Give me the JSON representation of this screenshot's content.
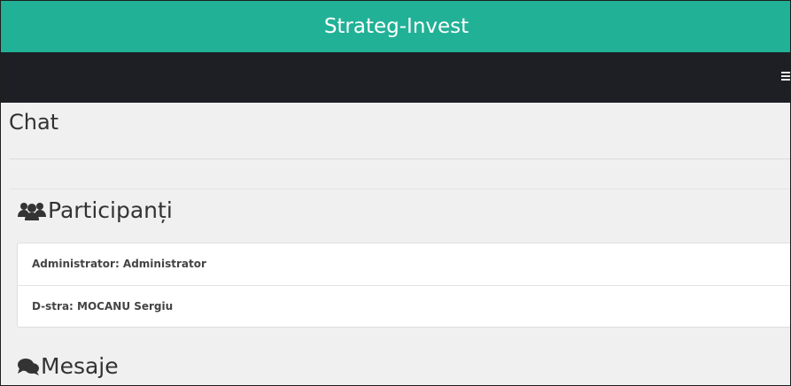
{
  "app": {
    "title": "Strateg-Invest"
  },
  "navbar": {
    "menu_icon": "hamburger-menu-icon"
  },
  "page": {
    "title": "Chat"
  },
  "participants": {
    "heading": "Participanți",
    "icon": "users-icon",
    "items": [
      "Administrator: Administrator",
      "D-stra: MOCANU Sergiu"
    ]
  },
  "messages": {
    "heading": "Mesaje",
    "icon": "comments-icon"
  },
  "colors": {
    "brand": "#21b196",
    "navbar": "#1d1f25",
    "background": "#f0f0f0"
  }
}
